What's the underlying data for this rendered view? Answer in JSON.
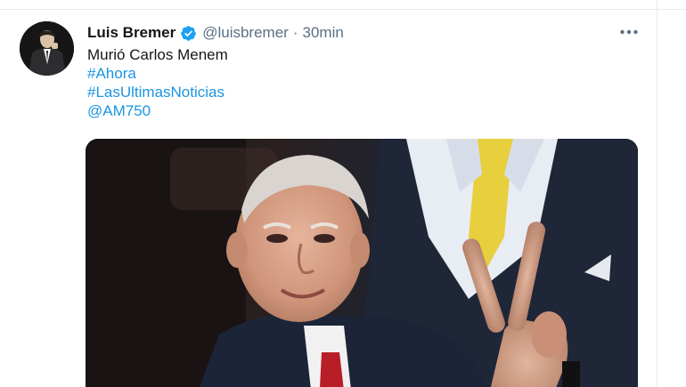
{
  "tweet": {
    "display_name": "Luis Bremer",
    "handle": "@luisbremer",
    "separator": "·",
    "time": "30min",
    "text": "Murió Carlos Menem",
    "hashtags": [
      "#Ahora",
      "#LasUltimasNoticias"
    ],
    "mention": "@AM750",
    "icons": {
      "verified": "verified-badge-icon",
      "more": "more-options-icon"
    },
    "colors": {
      "link": "#1b95e0",
      "verified": "#1da1f2",
      "secondary_text": "#5b7083"
    }
  }
}
